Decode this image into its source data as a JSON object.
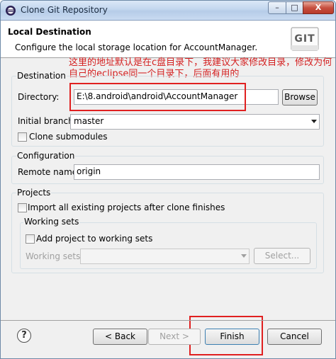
{
  "window": {
    "title": "Clone Git Repository",
    "minimize_glyph": "–",
    "maximize_glyph": "□",
    "close_glyph": "X"
  },
  "header": {
    "title": "Local Destination",
    "description": "Configure the local storage location for AccountManager.",
    "logo_text": "GIT"
  },
  "annotation": {
    "text": "这里的地址默认是在c盘目录下，我建议大家修改目录，修改为何自己的eclipse同一个目录下，后面有用的",
    "color": "#d42020"
  },
  "destination": {
    "legend": "Destination",
    "directory_label": "Directory:",
    "directory_value": "E:\\8.android\\android\\AccountManager",
    "browse_label": "Browse",
    "initial_branch_label": "Initial branch:",
    "initial_branch_value": "master",
    "clone_submodules_label": "Clone submodules",
    "clone_submodules_checked": false
  },
  "configuration": {
    "legend": "Configuration",
    "remote_name_label": "Remote name:",
    "remote_name_value": "origin"
  },
  "projects": {
    "legend": "Projects",
    "import_label": "Import all existing projects after clone finishes",
    "import_checked": false,
    "working_sets": {
      "legend": "Working sets",
      "add_label": "Add project to working sets",
      "add_checked": false,
      "working_sets_label": "Working sets:",
      "working_sets_value": "",
      "select_label": "Select..."
    }
  },
  "footer": {
    "help_glyph": "?",
    "back_label": "< Back",
    "next_label": "Next >",
    "finish_label": "Finish",
    "cancel_label": "Cancel"
  },
  "highlight_color": "#e02020"
}
